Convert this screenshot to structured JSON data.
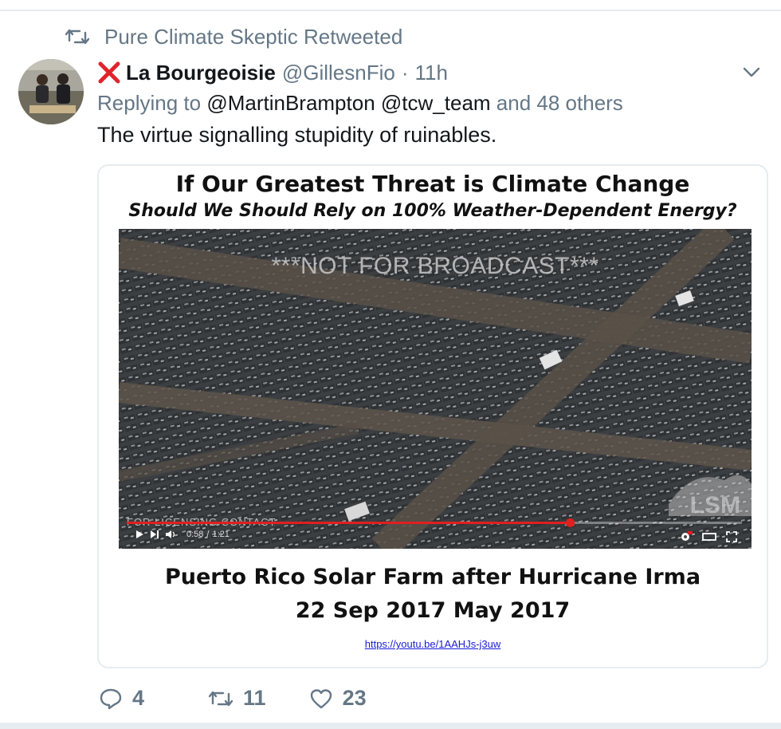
{
  "retweet_context": {
    "text": "Pure Climate Skeptic Retweeted"
  },
  "author": {
    "display_name": "La Bourgeoisie",
    "handle": "@GillesnFio",
    "separator": "·",
    "time": "11h"
  },
  "reply": {
    "prefix": "Replying to",
    "mention1": "@MartinBrampton",
    "mention2": "@tcw_team",
    "others": "and 48 others"
  },
  "tweet": {
    "text": "The virtue signalling stupidity of ruinables."
  },
  "media": {
    "title": "If Our Greatest Threat is Climate Change",
    "subtitle": "Should We Should Rely on 100% Weather-Dependent Energy?",
    "video": {
      "watermark": "***NOT FOR BROADCAST***",
      "licensing": "FOR LICENSING CONTACT",
      "time_current": "0:58",
      "time_total": "1:21",
      "progress": 0.72,
      "logo": "LSM"
    },
    "caption_line1": "Puerto Rico Solar Farm after Hurricane Irma",
    "caption_line2": "22 Sep 2017 May 2017",
    "link": "https://youtu.be/1AAHJs-j3uw"
  },
  "actions": {
    "replies": "4",
    "retweets": "11",
    "likes": "23"
  },
  "colors": {
    "secondary_text": "#657786",
    "x_mark": "#e0242b",
    "progress": "#e01f1f"
  }
}
